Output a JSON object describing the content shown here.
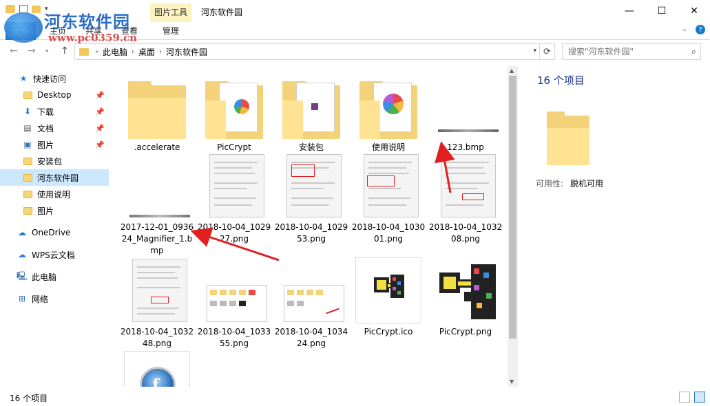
{
  "window": {
    "title": "河东软件园",
    "context_tab_group": "图片工具",
    "watermark_text": "河东软件园",
    "watermark_url": "www.pc0359.cn"
  },
  "ribbon": {
    "file_tab": "文件",
    "tabs": [
      "主页",
      "共享",
      "查看",
      "管理"
    ]
  },
  "address": {
    "crumbs": [
      "此电脑",
      "桌面",
      "河东软件园"
    ],
    "search_placeholder": "搜索\"河东软件园\""
  },
  "sidebar": {
    "items": [
      {
        "label": "快速访问",
        "icon": "star-icon",
        "pinned": false,
        "selected": false
      },
      {
        "label": "Desktop",
        "icon": "folder-icon",
        "pinned": true,
        "selected": false
      },
      {
        "label": "下载",
        "icon": "download-icon",
        "pinned": true,
        "selected": false
      },
      {
        "label": "文档",
        "icon": "document-icon",
        "pinned": true,
        "selected": false
      },
      {
        "label": "图片",
        "icon": "pictures-icon",
        "pinned": true,
        "selected": false
      },
      {
        "label": "安装包",
        "icon": "folder-icon",
        "pinned": false,
        "selected": false
      },
      {
        "label": "河东软件园",
        "icon": "folder-icon",
        "pinned": false,
        "selected": true
      },
      {
        "label": "使用说明",
        "icon": "folder-icon",
        "pinned": false,
        "selected": false
      },
      {
        "label": "图片",
        "icon": "folder-icon",
        "pinned": false,
        "selected": false
      },
      {
        "label": "OneDrive",
        "icon": "cloud-icon",
        "pinned": false,
        "selected": false
      },
      {
        "label": "WPS云文档",
        "icon": "wps-cloud-icon",
        "pinned": false,
        "selected": false
      },
      {
        "label": "此电脑",
        "icon": "computer-icon",
        "pinned": false,
        "selected": false
      },
      {
        "label": "网络",
        "icon": "network-icon",
        "pinned": false,
        "selected": false
      }
    ]
  },
  "files": [
    {
      "name": ".accelerate",
      "kind": "folder"
    },
    {
      "name": "PicCrypt",
      "kind": "folder-doc"
    },
    {
      "name": "安装包",
      "kind": "folder-doc"
    },
    {
      "name": "使用说明",
      "kind": "folder-doc"
    },
    {
      "name": "123.bmp",
      "kind": "bmp-strip"
    },
    {
      "name": "2017-12-01_093624_Magnifier_1.bmp",
      "kind": "bmp-strip"
    },
    {
      "name": "2018-10-04_102927.png",
      "kind": "screenshot"
    },
    {
      "name": "2018-10-04_102953.png",
      "kind": "screenshot"
    },
    {
      "name": "2018-10-04_103001.png",
      "kind": "screenshot"
    },
    {
      "name": "2018-10-04_103208.png",
      "kind": "screenshot"
    },
    {
      "name": "2018-10-04_103248.png",
      "kind": "screenshot"
    },
    {
      "name": "2018-10-04_103355.png",
      "kind": "explorer-shot"
    },
    {
      "name": "2018-10-04_103424.png",
      "kind": "explorer-shot"
    },
    {
      "name": "PicCrypt.ico",
      "kind": "key-icon"
    },
    {
      "name": "PicCrypt.png",
      "kind": "key-icon-large"
    },
    {
      "name": "",
      "kind": "app-icon"
    }
  ],
  "details": {
    "count": "16 个项目",
    "availability_label": "可用性:",
    "availability_value": "脱机可用"
  },
  "status": {
    "count": "16 个项目"
  },
  "colors": {
    "accent": "#1979ca",
    "selection": "#cce8ff",
    "annotation_arrow": "#e02020"
  }
}
